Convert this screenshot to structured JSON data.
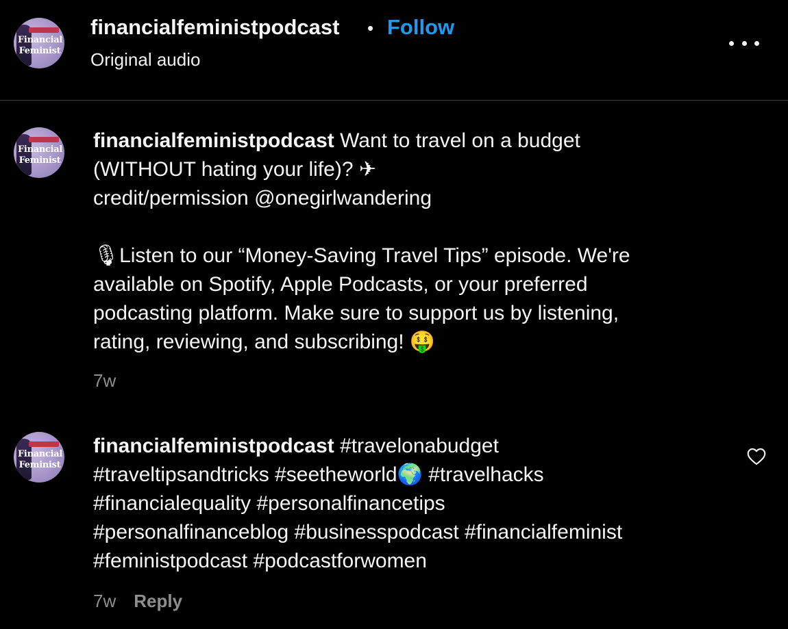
{
  "header": {
    "username": "financialfeministpodcast",
    "separator": "•",
    "follow_label": "Follow",
    "subtitle": "Original audio",
    "avatar_text": [
      "Financial",
      "Feminist"
    ]
  },
  "comments": [
    {
      "username": "financialfeministpodcast",
      "lines": [
        "Want to travel on a budget",
        "(WITHOUT hating your life)? ✈",
        "credit/permission @onegirlwandering",
        "",
        "🎙Listen to our “Money-Saving Travel Tips” episode. We're",
        "available on Spotify, Apple Podcasts, or your preferred",
        "podcasting platform. Make sure to support us by listening,",
        "rating, reviewing, and subscribing! 🤑"
      ],
      "time": "7w"
    },
    {
      "username": "financialfeministpodcast",
      "lines": [
        "#travelonabudget",
        "#traveltipsandtricks #seetheworld🌍 #travelhacks",
        "#financialequality #personalfinancetips",
        "#personalfinanceblog #businesspodcast #financialfeminist",
        "#feministpodcast #podcastforwomen"
      ],
      "time": "7w",
      "reply_label": "Reply"
    }
  ],
  "colors": {
    "background": "#000000",
    "accent": "#1d9bf0",
    "muted": "#8e8e8e"
  },
  "icons": [
    "more-options-icon",
    "heart-icon"
  ]
}
